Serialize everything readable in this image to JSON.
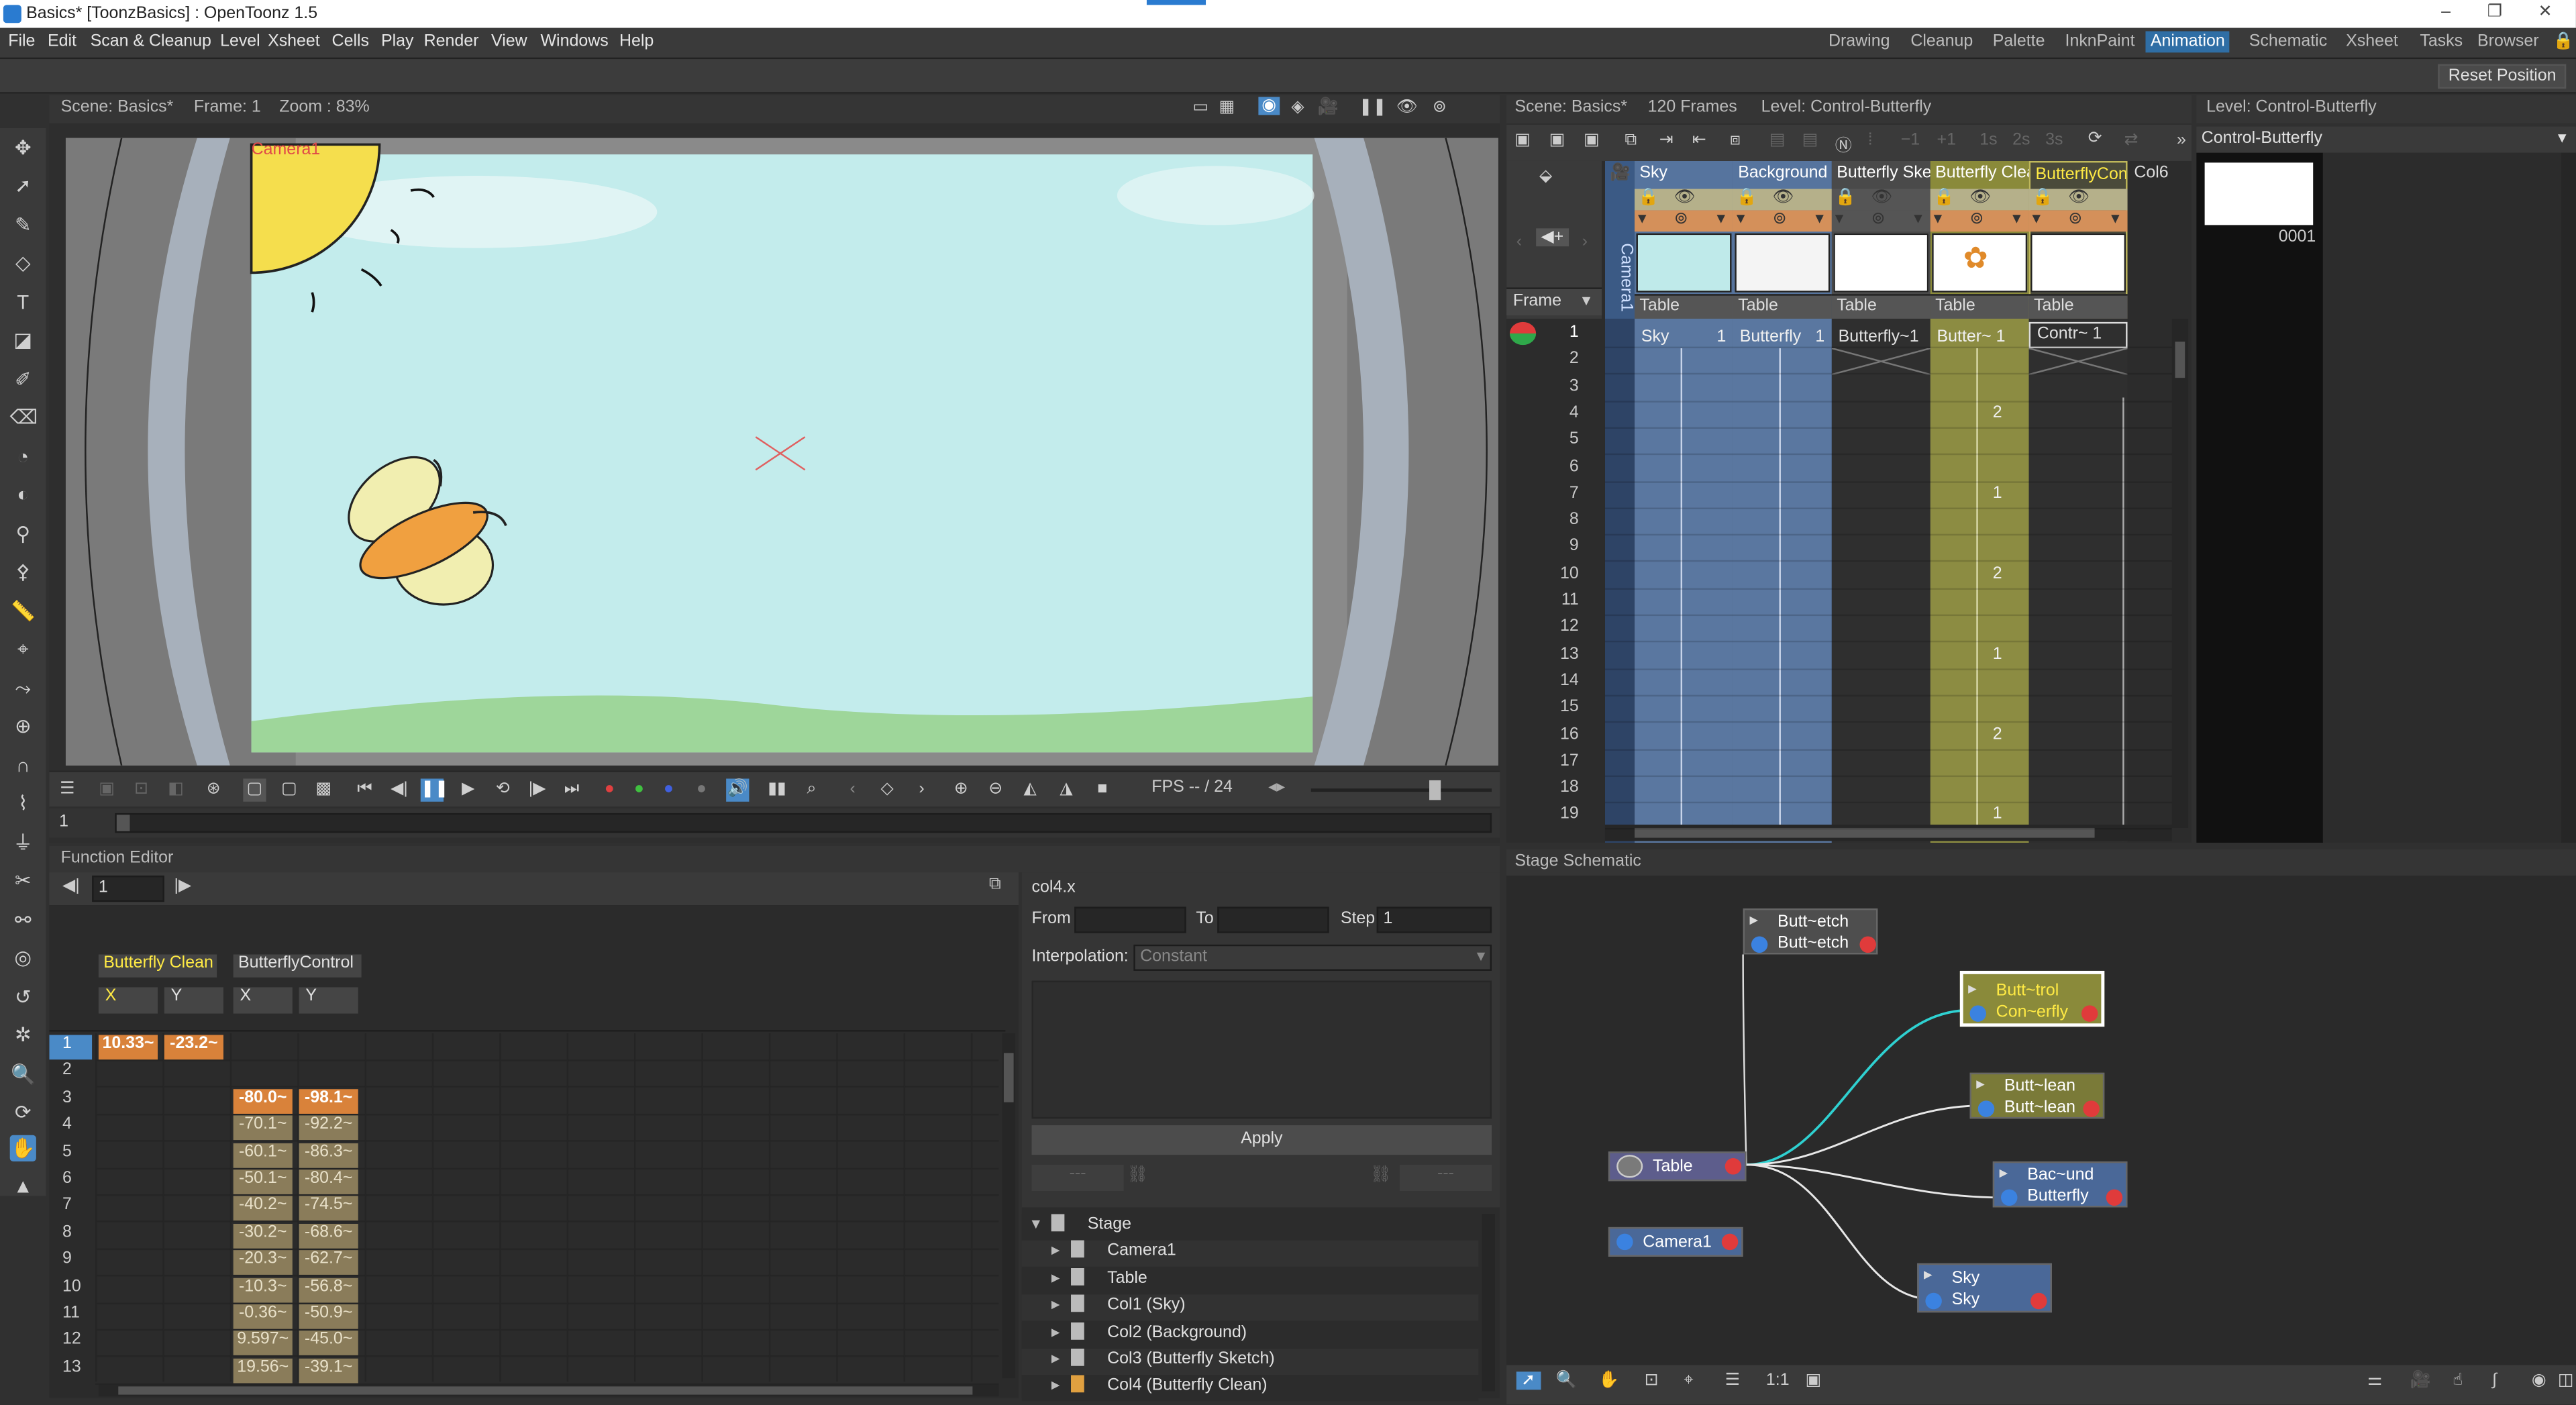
{
  "titlebar": {
    "title": "Basics* [ToonzBasics] : OpenToonz 1.5"
  },
  "menu": [
    "File",
    "Edit",
    "Scan & Cleanup",
    "Level",
    "Xsheet",
    "Cells",
    "Play",
    "Render",
    "View",
    "Windows",
    "Help"
  ],
  "rooms": [
    "Drawing",
    "Cleanup",
    "Palette",
    "InknPaint",
    "Animation",
    "Schematic",
    "Xsheet",
    "Tasks",
    "Browser"
  ],
  "active_room": "Animation",
  "reset_position": "Reset Position",
  "viewer": {
    "scene": "Scene: Basics*",
    "frame": "Frame: 1",
    "zoom": "Zoom : 83%",
    "camera_label": "Camera1",
    "fps_label": "FPS -- / 24",
    "frame_field": "1"
  },
  "xsheet": {
    "header": "Scene: Basics*",
    "frames": "120 Frames",
    "level": "Level: Control-Butterfly",
    "frame_label": "Frame",
    "camera_col": "Camera1",
    "columns": [
      {
        "name": "Sky",
        "peg": "Table",
        "color": "#5577a8",
        "cell1": "Sky",
        "cell1n": "1"
      },
      {
        "name": "Background",
        "peg": "Table",
        "color": "#5577a8",
        "cell1": "Butterfly",
        "cell1n": "1"
      },
      {
        "name": "Butterfly Sket",
        "peg": "Table",
        "color": "#4a4a4a",
        "cell1": "Butterfly~1",
        "cell1n": ""
      },
      {
        "name": "Butterfly Clea",
        "peg": "Table",
        "color": "#8b8b3a",
        "cell1": "Butter~ 1",
        "cell1n": ""
      },
      {
        "name": "ButterflyCont",
        "peg": "Table",
        "color": "#3f3f3f",
        "cell1": "Contr~ 1",
        "cell1n": ""
      }
    ],
    "col6": "Col6",
    "rows": [
      "1",
      "2",
      "3",
      "4",
      "5",
      "6",
      "7",
      "8",
      "9",
      "10",
      "11",
      "12",
      "13",
      "14",
      "15",
      "16",
      "17",
      "18",
      "19"
    ],
    "clean_marks": [
      {
        "row": 4,
        "v": "2"
      },
      {
        "row": 7,
        "v": "1"
      },
      {
        "row": 10,
        "v": "2"
      },
      {
        "row": 13,
        "v": "1"
      },
      {
        "row": 16,
        "v": "2"
      },
      {
        "row": 19,
        "v": "1"
      }
    ]
  },
  "level_strip": {
    "header": "Level: Control-Butterfly",
    "name": "Control-Butterfly",
    "frame": "0001"
  },
  "function_editor": {
    "title": "Function Editor",
    "frame_field": "1",
    "groups": [
      {
        "name": "Butterfly Clean",
        "cols": [
          "X",
          "Y"
        ]
      },
      {
        "name": "ButterflyControl",
        "cols": [
          "X",
          "Y"
        ]
      }
    ],
    "rows": [
      "1",
      "2",
      "3",
      "4",
      "5",
      "6",
      "7",
      "8",
      "9",
      "10",
      "11",
      "12",
      "13"
    ],
    "clean_x1": "10.33~",
    "clean_y1": "-23.2~",
    "control_x": [
      "-80.0~",
      "-70.1~",
      "-60.1~",
      "-50.1~",
      "-40.2~",
      "-30.2~",
      "-20.3~",
      "-10.3~",
      "-0.36~",
      "9.597~",
      "19.56~"
    ],
    "control_y": [
      "-98.1~",
      "-92.2~",
      "-86.3~",
      "-80.4~",
      "-74.5~",
      "-68.6~",
      "-62.7~",
      "-56.8~",
      "-50.9~",
      "-45.0~",
      "-39.1~"
    ],
    "segment": {
      "curve": "col4.x",
      "from_label": "From",
      "to_label": "To",
      "step_label": "Step",
      "step_value": "1",
      "interp_label": "Interpolation:",
      "interp_value": "Constant",
      "apply": "Apply",
      "dash1": "---",
      "dash2": "---"
    },
    "tree": [
      "Stage",
      "Camera1",
      "Table",
      "Col1 (Sky)",
      "Col2 (Background)",
      "Col3 (Butterfly Sketch)",
      "Col4 (Butterfly Clean)"
    ]
  },
  "schematic": {
    "title": "Stage Schematic",
    "nodes": [
      {
        "id": "sketch",
        "l1": "Butt~etch",
        "l2": "Butt~etch"
      },
      {
        "id": "control",
        "l1": "Butt~trol",
        "l2": "Con~erfly"
      },
      {
        "id": "clean",
        "l1": "Butt~lean",
        "l2": "Butt~lean"
      },
      {
        "id": "bg",
        "l1": "Bac~und",
        "l2": "Butterfly"
      },
      {
        "id": "sky",
        "l1": "Sky",
        "l2": "Sky"
      },
      {
        "id": "table",
        "l1": "Table"
      },
      {
        "id": "camera",
        "l1": "Camera1"
      }
    ],
    "zoom_label": "1:1"
  }
}
